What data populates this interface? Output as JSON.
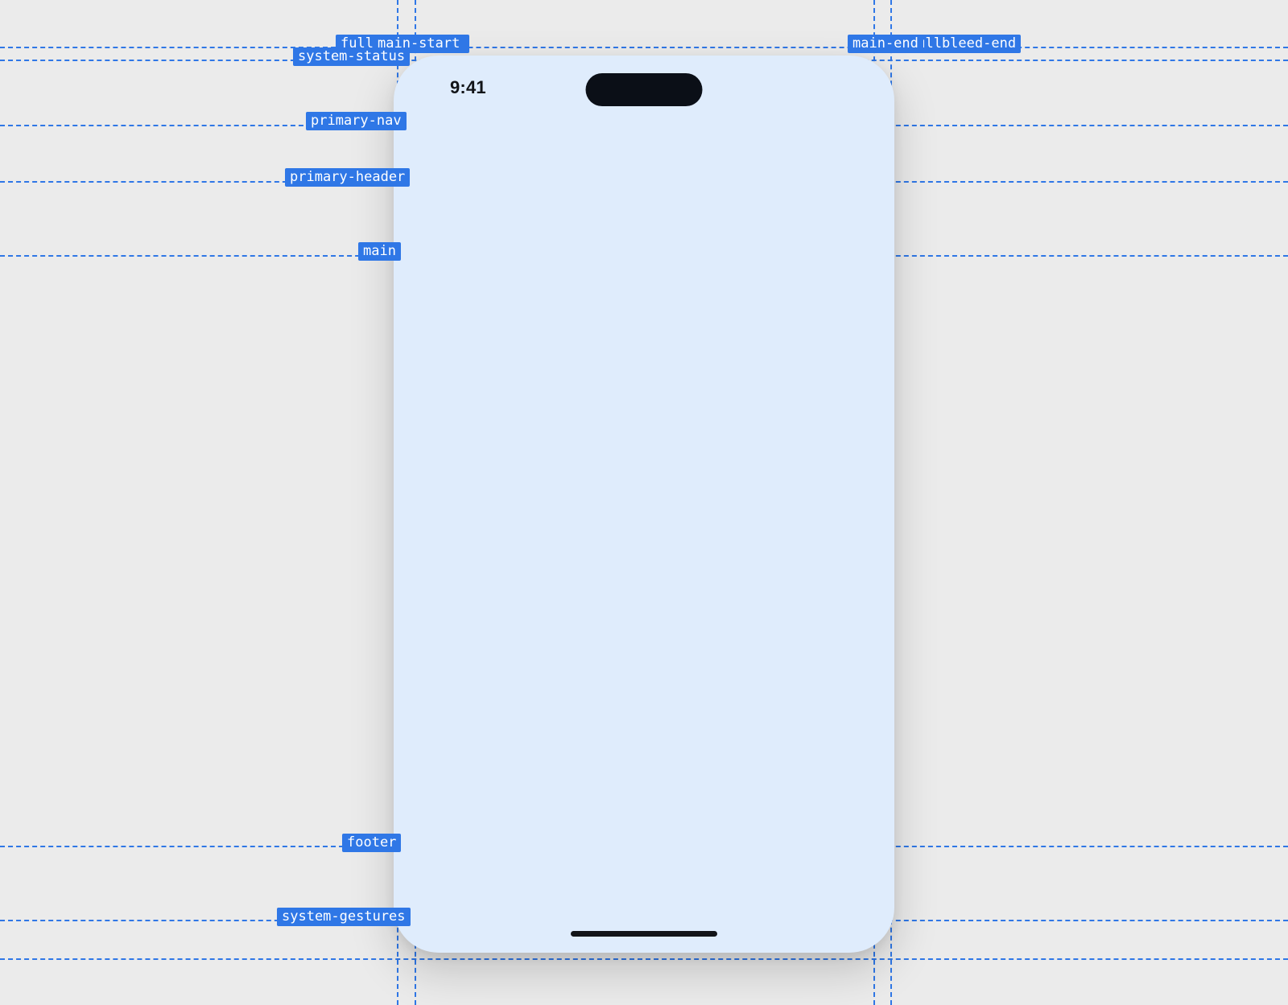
{
  "device": {
    "time": "9:41"
  },
  "guides": {
    "vertical": {
      "fullbleed_start": "fullbleed-start",
      "main_start": "main-start",
      "main_end": "main-end",
      "fullbleed_end": "fullbleed-end"
    },
    "horizontal": {
      "system_status": "system-status",
      "primary_nav": "primary-nav",
      "primary_header": "primary-header",
      "main": "main",
      "footer": "footer",
      "system_gestures": "system-gestures"
    }
  },
  "label_overlap": {
    "fullbleed_visible": "fullb",
    "fullbleed_end_visible": "d-end"
  }
}
